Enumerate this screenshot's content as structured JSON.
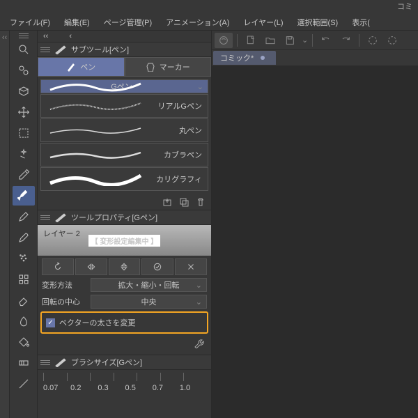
{
  "title_fragment": "コミ",
  "menubar": [
    "ファイル(F)",
    "編集(E)",
    "ページ管理(P)",
    "アニメーション(A)",
    "レイヤー(L)",
    "選択範囲(S)",
    "表示("
  ],
  "subtool": {
    "header": "サブツール[ペン]",
    "tabs": [
      {
        "label": "ペン",
        "active": true
      },
      {
        "label": "マーカー",
        "active": false
      }
    ],
    "brushes": [
      "Gペン",
      "リアルGペン",
      "丸ペン",
      "カブラペン",
      "カリグラフィ"
    ]
  },
  "toolprop": {
    "header": "ツールプロパティ[Gペン]",
    "layer_name": "レイヤー 2",
    "editing_label": "【 変形設定編集中 】",
    "rows": {
      "method_label": "変形方法",
      "method_value": "拡大・縮小・回転",
      "center_label": "回転の中心",
      "center_value": "中央"
    },
    "checkbox_label": "ベクターの太さを変更"
  },
  "brushsize": {
    "header": "ブラシサイズ[Gペン]",
    "values": [
      "0.07",
      "0.2",
      "0.3",
      "0.5",
      "0.7",
      "1.0"
    ]
  },
  "doc_tab": "コミック*"
}
